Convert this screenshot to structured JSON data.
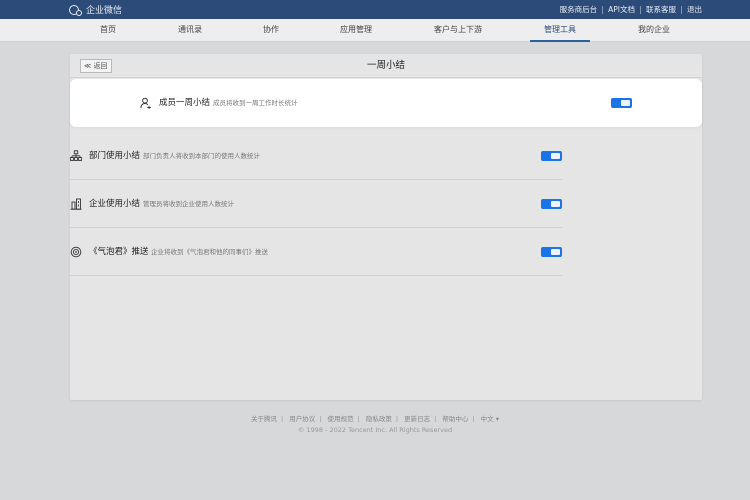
{
  "app": {
    "brand": "企业微信",
    "top_links": [
      "服务商后台",
      "API文档",
      "联系客服",
      "退出"
    ]
  },
  "nav": {
    "items": [
      "首页",
      "通讯录",
      "协作",
      "应用管理",
      "客户与上下游",
      "管理工具",
      "我的企业"
    ],
    "active": "管理工具"
  },
  "panel": {
    "back_label": "≪ 返回",
    "title": "一周小结"
  },
  "rows": [
    {
      "icon": "person-icon",
      "title": "成员一周小结",
      "desc": "成员将收到一周工作时长统计",
      "enabled": true
    },
    {
      "icon": "org-chart-icon",
      "title": "部门使用小结",
      "desc": "部门负责人将收到本部门的使用人数统计",
      "enabled": true
    },
    {
      "icon": "building-icon",
      "title": "企业使用小结",
      "desc": "管理员将收到企业使用人数统计",
      "enabled": true
    },
    {
      "icon": "bubble-icon",
      "title": "《气泡君》推送",
      "desc": "企业将收到《气泡君和他的同事们》推送",
      "enabled": true
    }
  ],
  "footer": {
    "links": [
      "关于腾讯",
      "用户协议",
      "使用规范",
      "隐私政策",
      "更新日志",
      "帮助中心",
      "中文 ▾"
    ],
    "copyright": "© 1998 - 2022 Tencent Inc. All Rights Reserved"
  },
  "colors": {
    "topbar": "#2c4b78",
    "toggle_on": "#1a73e8",
    "background": "#d7d8da"
  }
}
